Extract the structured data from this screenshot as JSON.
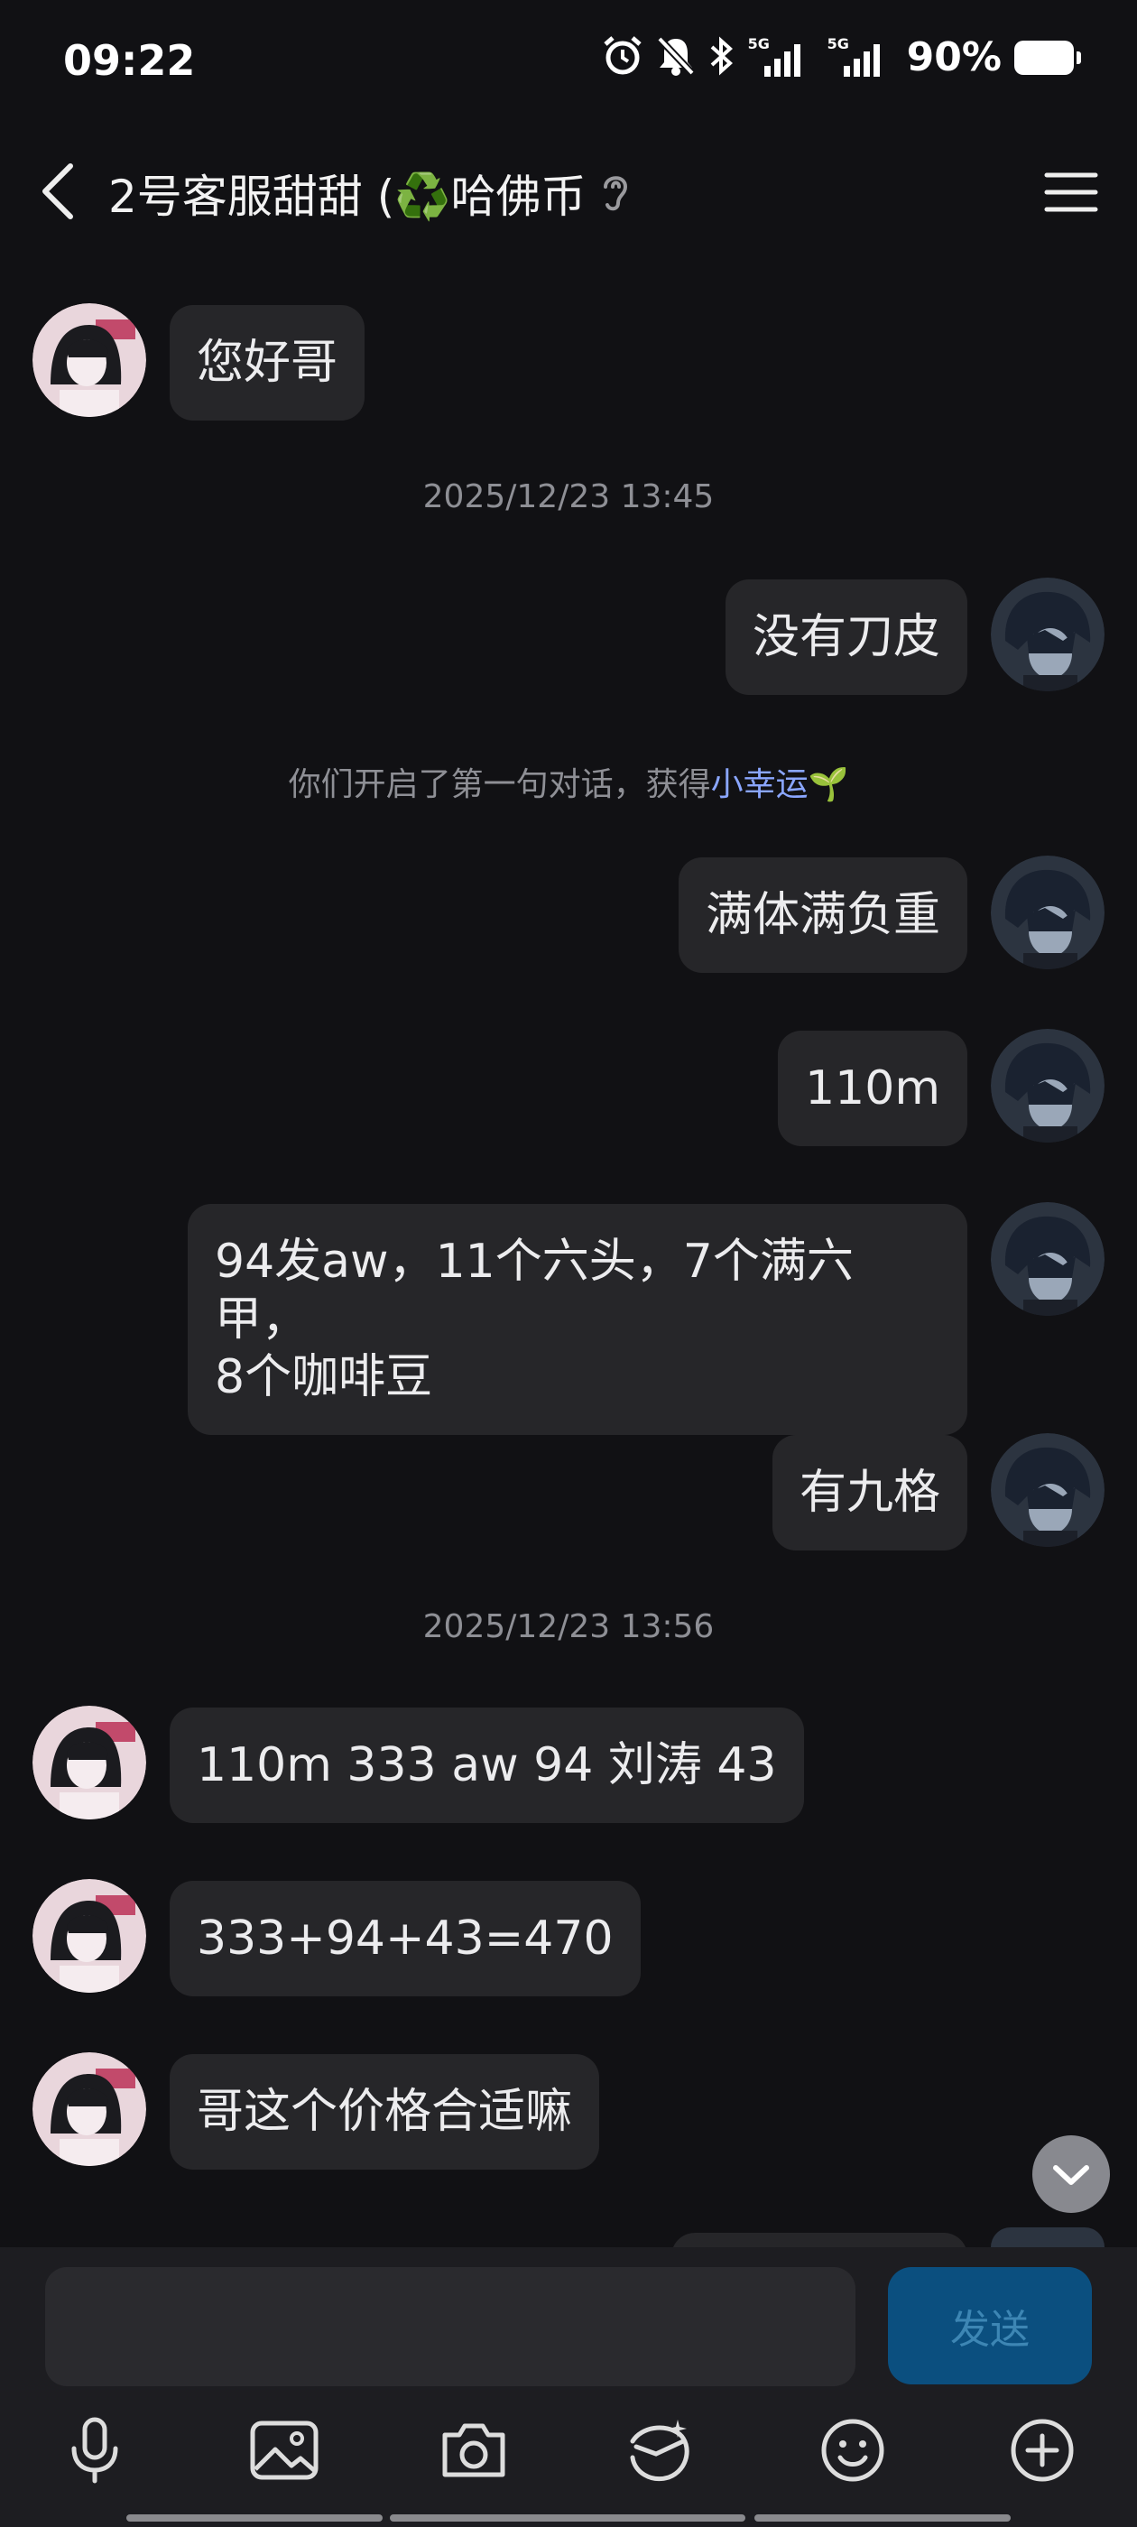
{
  "status_bar": {
    "time": "09:22",
    "network_1": "5G",
    "network_2": "5G",
    "battery_percent": "90%",
    "icons": [
      "alarm-icon",
      "mute-bell-icon",
      "bluetooth-icon",
      "signal-icon",
      "battery-icon"
    ]
  },
  "header": {
    "title": "2号客服甜甜 (♻️哈佛币",
    "icons": [
      "back-arrow-icon",
      "ear-icon",
      "menu-icon"
    ]
  },
  "messages": [
    {
      "side": "left",
      "text": "您好哥"
    },
    {
      "type": "timestamp",
      "text": "2025/12/23 13:45"
    },
    {
      "side": "right",
      "text": "没有刀皮"
    },
    {
      "type": "system",
      "text": "你们开启了第一句对话，获得",
      "highlight": "小幸运",
      "emoji": "🌱"
    },
    {
      "side": "right",
      "text": "满体满负重"
    },
    {
      "side": "right",
      "text": "110m"
    },
    {
      "side": "right",
      "lines": [
        "94发aw，11个六头，7个满六甲，",
        "8个咖啡豆"
      ]
    },
    {
      "side": "right",
      "text": "有九格"
    },
    {
      "type": "timestamp",
      "text": "2025/12/23 13:56"
    },
    {
      "side": "left",
      "text": "110m 333 aw 94 刘涛 43"
    },
    {
      "side": "left",
      "text": "333+94+43=470"
    },
    {
      "side": "left",
      "text": "哥这个价格合适嘛"
    }
  ],
  "input": {
    "value": "",
    "placeholder": "",
    "send_label": "发送"
  },
  "toolbar": {
    "items": [
      "microphone-icon",
      "image-icon",
      "camera-icon",
      "hongbao-icon",
      "emoji-icon",
      "plus-icon"
    ]
  },
  "colors": {
    "background": "#111114",
    "bubble": "#262629",
    "highlight": "#8aa6ff",
    "send_button": "#0b4f7f"
  }
}
